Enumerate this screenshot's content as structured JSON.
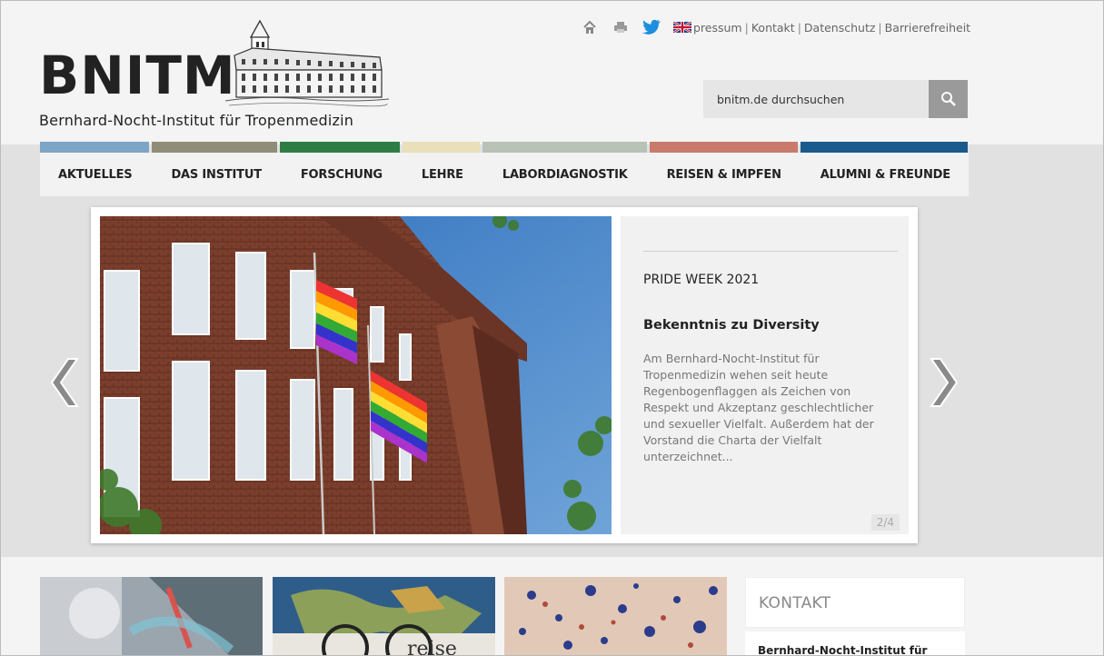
{
  "header": {
    "logo_text": "BNITM",
    "logo_subtitle": "Bernhard-Nocht-Institut für Tropenmedizin",
    "top_links": [
      "Impressum",
      "Kontakt",
      "Datenschutz",
      "Barrierefreiheit"
    ],
    "top_links_first_visible": "pressum",
    "icons": [
      "home-icon",
      "print-icon",
      "twitter-icon",
      "uk-flag-icon"
    ],
    "search": {
      "placeholder": "bnitm.de durchsuchen"
    }
  },
  "nav": {
    "colors": [
      "#7da5c6",
      "#8f8c78",
      "#2f7d45",
      "#e9dfb8",
      "#b8c2b6",
      "#c97a6b",
      "#1a5a8c"
    ],
    "items": [
      "AKTUELLES",
      "DAS INSTITUT",
      "FORSCHUNG",
      "LEHRE",
      "LABORDIAGNOSTIK",
      "REISEN & IMPFEN",
      "ALUMNI & FREUNDE"
    ]
  },
  "slider": {
    "kicker": "PRIDE WEEK 2021",
    "title": "Bekenntnis zu Diversity",
    "text": "Am Bernhard-Nocht-Institut für Tropenmedizin wehen seit heute Regenbogenflaggen als Zeichen von Respekt und Akzeptanz geschlechtlicher und sexueller Vielfalt. Außerdem hat der Vorstand die Charta der Vielfalt unterzeichnet...",
    "counter": "2/4"
  },
  "sidebar": {
    "kontakt_title": "KONTAKT",
    "kontakt_name": "Bernhard-Nocht-Institut für"
  },
  "tiles": {
    "travel_text": "reise"
  }
}
